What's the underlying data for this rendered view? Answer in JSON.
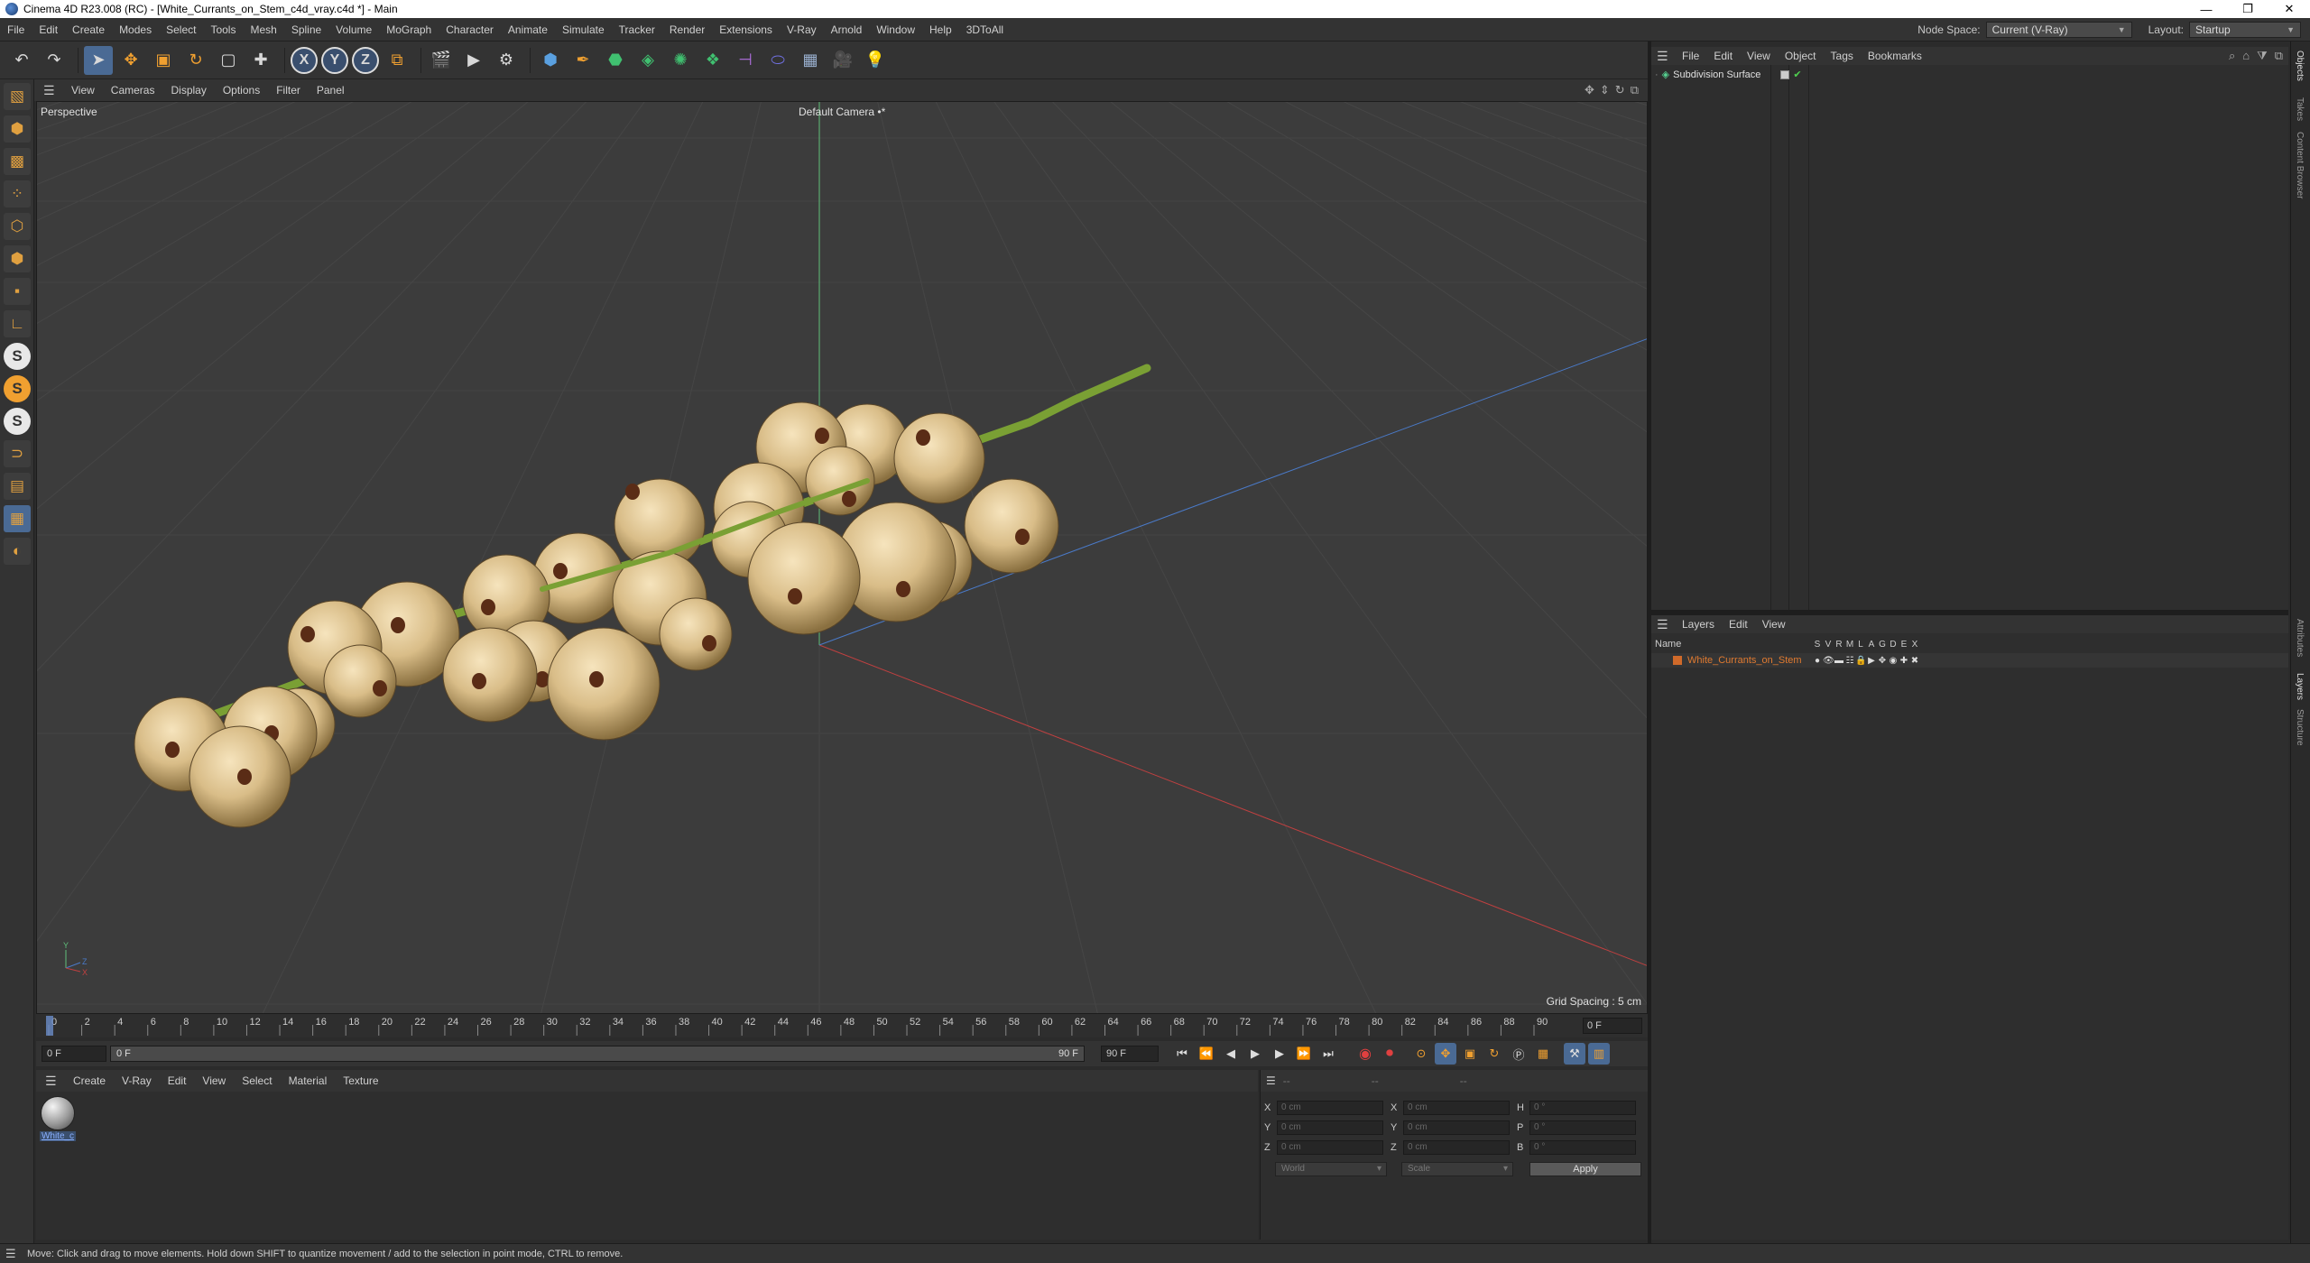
{
  "window": {
    "title": "Cinema 4D R23.008 (RC) - [White_Currants_on_Stem_c4d_vray.c4d *] - Main",
    "controls": [
      "—",
      "❐",
      "✕"
    ]
  },
  "menubar": {
    "items": [
      "File",
      "Edit",
      "Create",
      "Modes",
      "Select",
      "Tools",
      "Mesh",
      "Spline",
      "Volume",
      "MoGraph",
      "Character",
      "Animate",
      "Simulate",
      "Tracker",
      "Render",
      "Extensions",
      "V-Ray",
      "Arnold",
      "Window",
      "Help",
      "3DToAll"
    ],
    "node_space_label": "Node Space:",
    "node_space_value": "Current (V-Ray)",
    "layout_label": "Layout:",
    "layout_value": "Startup"
  },
  "toolbar": {
    "icons": [
      {
        "name": "undo-icon",
        "glyph": "↶"
      },
      {
        "name": "redo-icon",
        "glyph": "↷"
      },
      {
        "name": "select-icon",
        "glyph": "➤"
      },
      {
        "name": "move-icon",
        "glyph": "✥"
      },
      {
        "name": "scale-icon",
        "glyph": "▣"
      },
      {
        "name": "rotate-icon",
        "glyph": "↻"
      },
      {
        "name": "placeholder-icon",
        "glyph": "▢"
      },
      {
        "name": "add-icon",
        "glyph": "✚"
      }
    ],
    "axes": [
      "X",
      "Y",
      "Z"
    ],
    "render_icons": [
      {
        "name": "coordinate-system-icon",
        "glyph": "⧉"
      },
      {
        "name": "render-region-icon",
        "glyph": "🎬"
      },
      {
        "name": "render-view-icon",
        "glyph": "▶"
      },
      {
        "name": "render-settings-icon",
        "glyph": "⚙"
      }
    ],
    "object_icons": [
      {
        "name": "cube-icon",
        "glyph": "⬢"
      },
      {
        "name": "pen-icon",
        "glyph": "✒"
      },
      {
        "name": "generator-icon",
        "glyph": "⬣"
      },
      {
        "name": "subdivision-icon",
        "glyph": "◈"
      },
      {
        "name": "cloner-icon",
        "glyph": "✺"
      },
      {
        "name": "deformer-icon",
        "glyph": "❖"
      },
      {
        "name": "field-icon",
        "glyph": "⊣"
      },
      {
        "name": "tag-icon",
        "glyph": "⬭"
      },
      {
        "name": "floor-icon",
        "glyph": "▦"
      },
      {
        "name": "camera-icon",
        "glyph": "🎥"
      },
      {
        "name": "light-icon",
        "glyph": "💡"
      }
    ]
  },
  "leftbar": {
    "icons": [
      {
        "name": "make-editable-icon",
        "glyph": "▧",
        "style": ""
      },
      {
        "name": "model-mode-icon",
        "glyph": "⬢",
        "style": ""
      },
      {
        "name": "texture-mode-icon",
        "glyph": "▩",
        "style": ""
      },
      {
        "name": "points-mode-icon",
        "glyph": "⁘",
        "style": ""
      },
      {
        "name": "edges-mode-icon",
        "glyph": "⬡",
        "style": ""
      },
      {
        "name": "polygons-mode-icon",
        "glyph": "⬢",
        "style": ""
      },
      {
        "name": "uv-mode-icon",
        "glyph": "▪",
        "style": ""
      },
      {
        "name": "axis-mode-icon",
        "glyph": "∟",
        "style": ""
      },
      {
        "name": "snap-icon",
        "glyph": "S",
        "style": "s"
      },
      {
        "name": "snap-settings-icon",
        "glyph": "S",
        "style": "s"
      },
      {
        "name": "soft-select-icon",
        "glyph": "S",
        "style": "s"
      },
      {
        "name": "magnet-icon",
        "glyph": "⊃",
        "style": ""
      },
      {
        "name": "workplane-icon",
        "glyph": "▤",
        "style": ""
      },
      {
        "name": "grid-icon",
        "glyph": "▦",
        "style": ""
      },
      {
        "name": "locked-workplane-icon",
        "glyph": "◐",
        "style": ""
      }
    ]
  },
  "viewport": {
    "menu": [
      "View",
      "Cameras",
      "Display",
      "Options",
      "Filter",
      "Panel"
    ],
    "view_name": "Perspective",
    "camera": "Default Camera •*",
    "grid_spacing": "Grid Spacing : 5 cm",
    "axis_labels": {
      "y": "Y",
      "z": "Z",
      "x": "X"
    },
    "nav_icons": [
      "✥",
      "⇕",
      "↻",
      "⧉"
    ]
  },
  "timeline": {
    "ticks": [
      0,
      2,
      4,
      6,
      8,
      10,
      12,
      14,
      16,
      18,
      20,
      22,
      24,
      26,
      28,
      30,
      32,
      34,
      36,
      38,
      40,
      42,
      44,
      46,
      48,
      50,
      52,
      54,
      56,
      58,
      60,
      62,
      64,
      66,
      68,
      70,
      72,
      74,
      76,
      78,
      80,
      82,
      84,
      86,
      88,
      90
    ],
    "current_frame": 0,
    "end_field": "0 F"
  },
  "transport": {
    "start": "0 F",
    "range_start": "0 F",
    "range_end": "90 F",
    "end": "90 F",
    "buttons": [
      "⏮",
      "⏭",
      "◀",
      "▶",
      "▶",
      "⏭",
      "⏭"
    ]
  },
  "materials": {
    "menu": [
      "Create",
      "V-Ray",
      "Edit",
      "View",
      "Select",
      "Material",
      "Texture"
    ],
    "items": [
      {
        "name": "White_c"
      }
    ]
  },
  "coordinates": {
    "header": [
      "--",
      "--",
      "--"
    ],
    "rows": [
      {
        "l1": "X",
        "v1": "0 cm",
        "l2": "X",
        "v2": "0 cm",
        "l3": "H",
        "v3": "0 °"
      },
      {
        "l1": "Y",
        "v1": "0 cm",
        "l2": "Y",
        "v2": "0 cm",
        "l3": "P",
        "v3": "0 °"
      },
      {
        "l1": "Z",
        "v1": "0 cm",
        "l2": "Z",
        "v2": "0 cm",
        "l3": "B",
        "v3": "0 °"
      }
    ],
    "space": "World",
    "mode": "Scale",
    "apply": "Apply"
  },
  "objects": {
    "menu": [
      "File",
      "Edit",
      "View",
      "Object",
      "Tags",
      "Bookmarks"
    ],
    "items": [
      {
        "name": "Subdivision Surface"
      }
    ]
  },
  "layers": {
    "menu": [
      "Layers",
      "Edit",
      "View"
    ],
    "header_name": "Name",
    "flags": [
      "S",
      "V",
      "R",
      "M",
      "L",
      "A",
      "G",
      "D",
      "E",
      "X"
    ],
    "items": [
      {
        "name": "White_Currants_on_Stem",
        "color": "#d06a2a"
      }
    ]
  },
  "side_tabs": [
    "Objects",
    "Takes",
    "Content Browser",
    "Attributes",
    "Layers",
    "Structure"
  ],
  "status": "Move: Click and drag to move elements. Hold down SHIFT to quantize movement / add to the selection in point mode, CTRL to remove.",
  "colors": {
    "accent": "#4a6a94",
    "layer": "#d06a2a",
    "berry": "#e6cfa0",
    "stem": "#7aa034"
  }
}
